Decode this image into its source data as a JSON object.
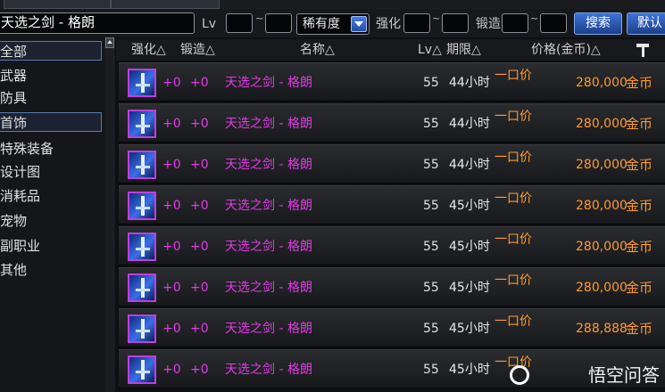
{
  "search": {
    "item_name": "天选之剑 - 格朗",
    "lv_label": "Lv",
    "tilde": "~",
    "rarity_selected": "稀有度",
    "enhance_label": "强化",
    "forge_label": "锻造",
    "search_button": "搜索",
    "default_button": "默认"
  },
  "sidebar": {
    "categories": [
      "全部",
      "武器",
      "防具",
      "首饰",
      "特殊装备",
      "设计图",
      "消耗品",
      "宠物",
      "副职业",
      "其他"
    ],
    "selected_index": 0
  },
  "table_header": {
    "enhance": "强化△",
    "forge": "锻造△",
    "name": "名称△",
    "lv": "Lv△",
    "period": "期限△",
    "price": "价格(金币)△"
  },
  "rows": [
    {
      "enhance": "+0",
      "forge": "+0",
      "name": "天选之剑 - 格朗",
      "lv": "55",
      "period": "44小时",
      "sale_type": "一口价",
      "price": "280,000",
      "currency": "金币"
    },
    {
      "enhance": "+0",
      "forge": "+0",
      "name": "天选之剑 - 格朗",
      "lv": "55",
      "period": "44小时",
      "sale_type": "一口价",
      "price": "280,000",
      "currency": "金币"
    },
    {
      "enhance": "+0",
      "forge": "+0",
      "name": "天选之剑 - 格朗",
      "lv": "55",
      "period": "44小时",
      "sale_type": "一口价",
      "price": "280,000",
      "currency": "金币"
    },
    {
      "enhance": "+0",
      "forge": "+0",
      "name": "天选之剑 - 格朗",
      "lv": "55",
      "period": "45小时",
      "sale_type": "一口价",
      "price": "280,000",
      "currency": "金币"
    },
    {
      "enhance": "+0",
      "forge": "+0",
      "name": "天选之剑 - 格朗",
      "lv": "55",
      "period": "45小时",
      "sale_type": "一口价",
      "price": "280,000",
      "currency": "金币"
    },
    {
      "enhance": "+0",
      "forge": "+0",
      "name": "天选之剑 - 格朗",
      "lv": "55",
      "period": "45小时",
      "sale_type": "一口价",
      "price": "280,000",
      "currency": "金币"
    },
    {
      "enhance": "+0",
      "forge": "+0",
      "name": "天选之剑 - 格朗",
      "lv": "55",
      "period": "45小时",
      "sale_type": "一口价",
      "price": "288,888",
      "currency": "金币"
    },
    {
      "enhance": "+0",
      "forge": "+0",
      "name": "天选之剑 - 格朗",
      "lv": "55",
      "period": "45小时",
      "sale_type": "一口价",
      "price": "",
      "currency": ""
    }
  ],
  "watermark": "悟空问答",
  "colors": {
    "accent": "#e23be6",
    "price": "#ff9a2e",
    "button": "#2a58b8"
  }
}
